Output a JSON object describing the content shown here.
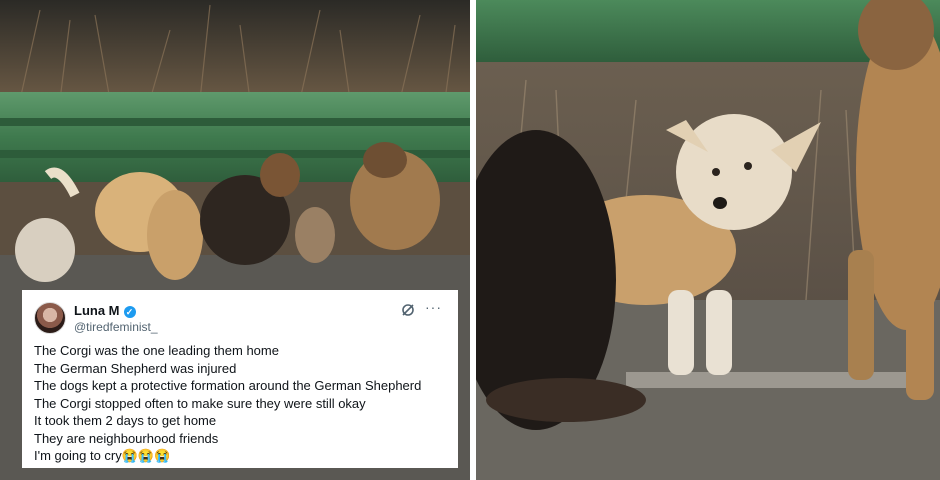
{
  "tweet": {
    "display_name": "Luna M",
    "handle": "@tiredfeminist_",
    "verified_glyph": "✓",
    "more_glyph": "···",
    "lines": [
      "The Corgi was the one leading them home",
      "The German Shepherd was injured",
      "The dogs kept a protective formation around the German Shepherd",
      "The Corgi stopped often to make sure they were still okay",
      "It took them 2 days to get home",
      "They are neighbourhood friends",
      "I'm going to cry😭😭😭"
    ]
  },
  "icons": {
    "verified": "verified-badge-icon",
    "grok": "grok-icon",
    "more": "more-icon"
  },
  "colors": {
    "guardrail": "#4f8a5e",
    "verified": "#1d9bf0",
    "text": "#0f1419",
    "muted": "#536471"
  }
}
